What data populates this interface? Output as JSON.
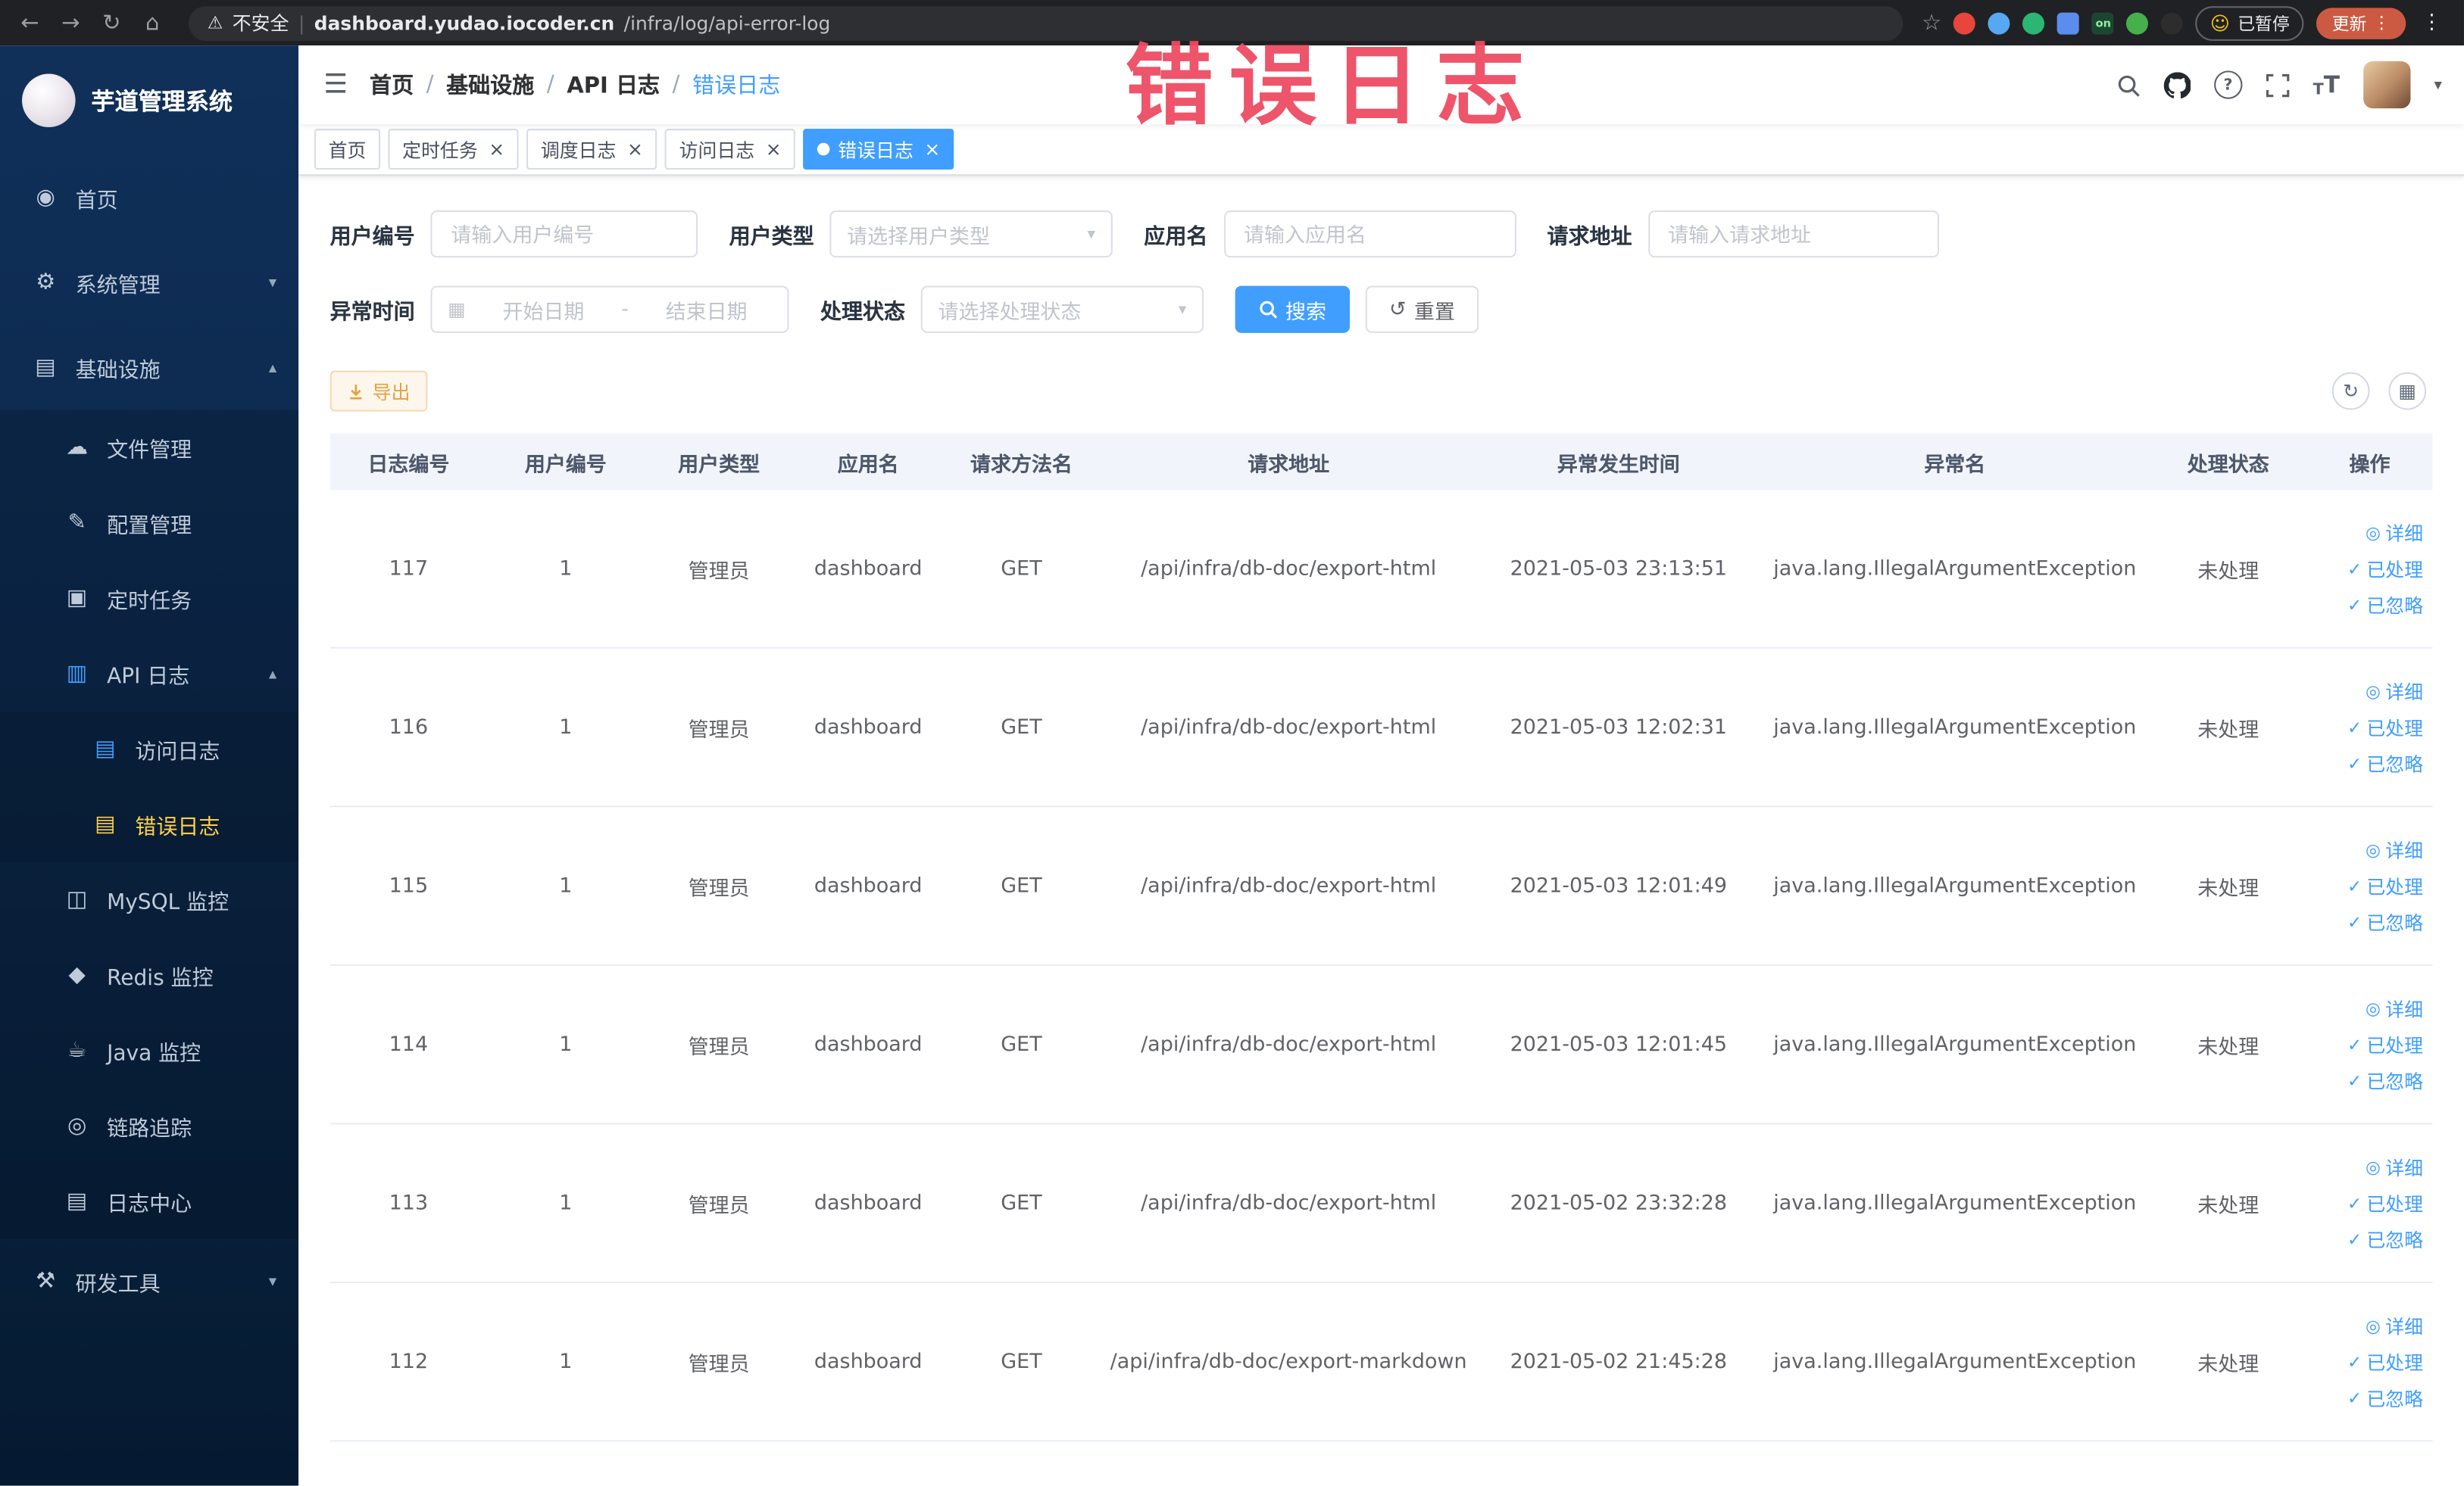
{
  "colors": {
    "primary": "#409eff",
    "active-gold": "#ffd04b",
    "warning": "#e6a23c",
    "annotation": "#ee4b63"
  },
  "annotation": {
    "text": "错误日志"
  },
  "browser": {
    "security_label": "不安全",
    "url_domain": "dashboard.yudao.iocoder.cn",
    "url_path": "/infra/log/api-error-log",
    "paused_badge": "已暂停",
    "update_label": "更新",
    "extensions": [
      {
        "name": "extension-red-icon",
        "color": "#e8453c",
        "shape": "circle",
        "label": ""
      },
      {
        "name": "extension-blue-icon",
        "color": "#57a7f2",
        "shape": "circle",
        "label": ""
      },
      {
        "name": "extension-green-circle-icon",
        "color": "#2bb673",
        "shape": "circle",
        "label": ""
      },
      {
        "name": "extension-grid-icon",
        "color": "#5b8def",
        "shape": "square",
        "label": ""
      },
      {
        "name": "extension-on-icon",
        "color": "#1d4632",
        "shape": "square",
        "label": "on"
      },
      {
        "name": "extension-leaf-icon",
        "color": "#46b04a",
        "shape": "circle",
        "label": ""
      },
      {
        "name": "extension-paw-icon",
        "color": "#2d2d2d",
        "shape": "circle",
        "label": ""
      }
    ]
  },
  "sidebar": {
    "logo_title": "芋道管理系统",
    "menu": [
      {
        "label": "首页",
        "name": "home",
        "icon": "dashboard-icon",
        "glyph": "◉",
        "level": 0
      },
      {
        "label": "系统管理",
        "name": "system",
        "icon": "gear-icon",
        "glyph": "⚙",
        "level": 0,
        "chevron": "down"
      },
      {
        "label": "基础设施",
        "name": "infrastructure",
        "icon": "infra-icon",
        "glyph": "▤",
        "level": 0,
        "chevron": "up"
      },
      {
        "label": "文件管理",
        "name": "file-manage",
        "icon": "cloud-icon",
        "glyph": "☁",
        "level": 1
      },
      {
        "label": "配置管理",
        "name": "config-manage",
        "icon": "edit-icon",
        "glyph": "✎",
        "level": 1
      },
      {
        "label": "定时任务",
        "name": "scheduled-jobs",
        "icon": "job-icon",
        "glyph": "▣",
        "level": 1
      },
      {
        "label": "API 日志",
        "name": "api-log",
        "icon": "log-doc-icon",
        "glyph": "▥",
        "level": 1,
        "chevron": "up",
        "icon_color": "#409eff"
      },
      {
        "label": "访问日志",
        "name": "access-log",
        "icon": "doc-icon",
        "glyph": "▤",
        "level": 2,
        "icon_color": "#409eff"
      },
      {
        "label": "错误日志",
        "name": "error-log",
        "icon": "doc-icon",
        "glyph": "▤",
        "level": 2,
        "active": true
      },
      {
        "label": "MySQL 监控",
        "name": "mysql-monitor",
        "icon": "database-icon",
        "glyph": "◫",
        "level": 1
      },
      {
        "label": "Redis 监控",
        "name": "redis-monitor",
        "icon": "redis-icon",
        "glyph": "◆",
        "level": 1
      },
      {
        "label": "Java 监控",
        "name": "java-monitor",
        "icon": "coffee-icon",
        "glyph": "☕",
        "level": 1
      },
      {
        "label": "链路追踪",
        "name": "tracing",
        "icon": "trace-icon",
        "glyph": "◎",
        "level": 1
      },
      {
        "label": "日志中心",
        "name": "log-center",
        "icon": "doc-icon",
        "glyph": "▤",
        "level": 1
      },
      {
        "label": "研发工具",
        "name": "dev-tools",
        "icon": "tools-icon",
        "glyph": "⚒",
        "level": 0,
        "chevron": "down"
      }
    ]
  },
  "header": {
    "separator": "/",
    "breadcrumb": [
      "首页",
      "基础设施",
      "API 日志",
      "错误日志"
    ]
  },
  "tabs": [
    {
      "label": "首页",
      "closable": false,
      "active": false
    },
    {
      "label": "定时任务",
      "closable": true,
      "active": false
    },
    {
      "label": "调度日志",
      "closable": true,
      "active": false
    },
    {
      "label": "访问日志",
      "closable": true,
      "active": false
    },
    {
      "label": "错误日志",
      "closable": true,
      "active": true
    }
  ],
  "filters": {
    "fields": [
      {
        "label": "用户编号",
        "type": "input",
        "name": "user-no",
        "placeholder": "请输入用户编号"
      },
      {
        "label": "用户类型",
        "type": "select",
        "name": "user-type",
        "placeholder": "请选择用户类型"
      },
      {
        "label": "应用名",
        "type": "input",
        "name": "app-name",
        "placeholder": "请输入应用名"
      },
      {
        "label": "请求地址",
        "type": "input",
        "name": "request-url",
        "placeholder": "请输入请求地址"
      },
      {
        "label": "异常时间",
        "type": "daterange",
        "name": "exception-time",
        "start_placeholder": "开始日期",
        "end_placeholder": "结束日期",
        "separator": "-"
      },
      {
        "label": "处理状态",
        "type": "select",
        "name": "process-status",
        "placeholder": "请选择处理状态"
      }
    ],
    "search_label": "搜索",
    "reset_label": "重置"
  },
  "toolbar": {
    "export_label": "导出"
  },
  "table": {
    "columns": [
      "日志编号",
      "用户编号",
      "用户类型",
      "应用名",
      "请求方法名",
      "请求地址",
      "异常发生时间",
      "异常名",
      "处理状态",
      "操作"
    ],
    "rows": [
      [
        "117",
        "1",
        "管理员",
        "dashboard",
        "GET",
        "/api/infra/db-doc/export-html",
        "2021-05-03 23:13:51",
        "java.lang.IllegalArgumentException",
        "未处理"
      ],
      [
        "116",
        "1",
        "管理员",
        "dashboard",
        "GET",
        "/api/infra/db-doc/export-html",
        "2021-05-03 12:02:31",
        "java.lang.IllegalArgumentException",
        "未处理"
      ],
      [
        "115",
        "1",
        "管理员",
        "dashboard",
        "GET",
        "/api/infra/db-doc/export-html",
        "2021-05-03 12:01:49",
        "java.lang.IllegalArgumentException",
        "未处理"
      ],
      [
        "114",
        "1",
        "管理员",
        "dashboard",
        "GET",
        "/api/infra/db-doc/export-html",
        "2021-05-03 12:01:45",
        "java.lang.IllegalArgumentException",
        "未处理"
      ],
      [
        "113",
        "1",
        "管理员",
        "dashboard",
        "GET",
        "/api/infra/db-doc/export-html",
        "2021-05-02 23:32:28",
        "java.lang.IllegalArgumentException",
        "未处理"
      ],
      [
        "112",
        "1",
        "管理员",
        "dashboard",
        "GET",
        "/api/infra/db-doc/export-markdown",
        "2021-05-02 21:45:28",
        "java.lang.IllegalArgumentException",
        "未处理"
      ]
    ]
  },
  "row_actions": {
    "detail": "详细",
    "done": "已处理",
    "ignore": "已忽略"
  }
}
